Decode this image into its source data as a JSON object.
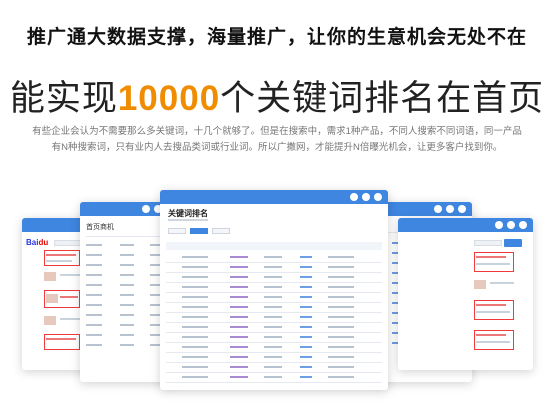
{
  "headline": "推广通大数据支撑，海量推广，让你的生意机会无处不在",
  "title": {
    "prefix": "能实现",
    "highlight": "10000",
    "suffix": "个关键词排名在首页"
  },
  "description": {
    "line1": "有些企业会认为不需要那么多关键词，十几个就够了。但是在搜索中，需求1种产品，不同人搜索不同词语，同一产品",
    "line2": "有N种搜索词，只有业内人去搜品类词或行业词。所以广撒网，才能提升N倍曝光机会，让更多客户找到你。"
  },
  "screens": {
    "left_panel_title": "首页商机",
    "center_title": "关键词排名"
  },
  "colors": {
    "accent": "#f08c00",
    "window_bar": "#3f86e0",
    "rank_mark": "#a78bd5"
  }
}
